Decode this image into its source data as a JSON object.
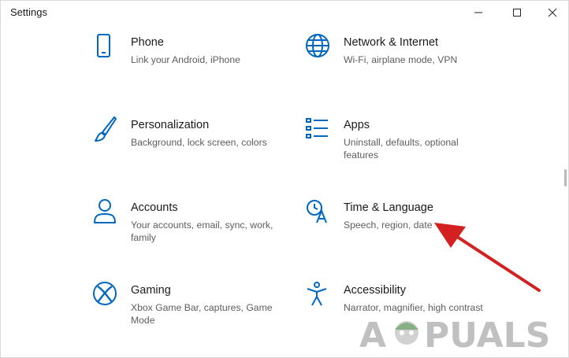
{
  "window": {
    "title": "Settings",
    "controls": {
      "minimize_icon": "minimize-icon",
      "maximize_icon": "maximize-icon",
      "close_icon": "close-icon"
    }
  },
  "accent_color": "#0067c0",
  "items": [
    {
      "id": "phone",
      "label": "Phone",
      "desc": "Link your Android, iPhone",
      "icon": "phone-icon"
    },
    {
      "id": "network",
      "label": "Network & Internet",
      "desc": "Wi-Fi, airplane mode, VPN",
      "icon": "globe-icon"
    },
    {
      "id": "personalization",
      "label": "Personalization",
      "desc": "Background, lock screen, colors",
      "icon": "paintbrush-icon"
    },
    {
      "id": "apps",
      "label": "Apps",
      "desc": "Uninstall, defaults, optional features",
      "icon": "apps-list-icon"
    },
    {
      "id": "accounts",
      "label": "Accounts",
      "desc": "Your accounts, email, sync, work, family",
      "icon": "person-icon"
    },
    {
      "id": "time",
      "label": "Time & Language",
      "desc": "Speech, region, date",
      "icon": "time-language-icon"
    },
    {
      "id": "gaming",
      "label": "Gaming",
      "desc": "Xbox Game Bar, captures, Game Mode",
      "icon": "xbox-icon"
    },
    {
      "id": "accessibility",
      "label": "Accessibility",
      "desc": "Narrator, magnifier, high contrast",
      "icon": "accessibility-icon"
    }
  ],
  "annotation": {
    "arrow_color": "#d32020",
    "arrow_target": "Time & Language"
  },
  "watermark": {
    "text_left": "A",
    "text_right": "PUALS"
  }
}
